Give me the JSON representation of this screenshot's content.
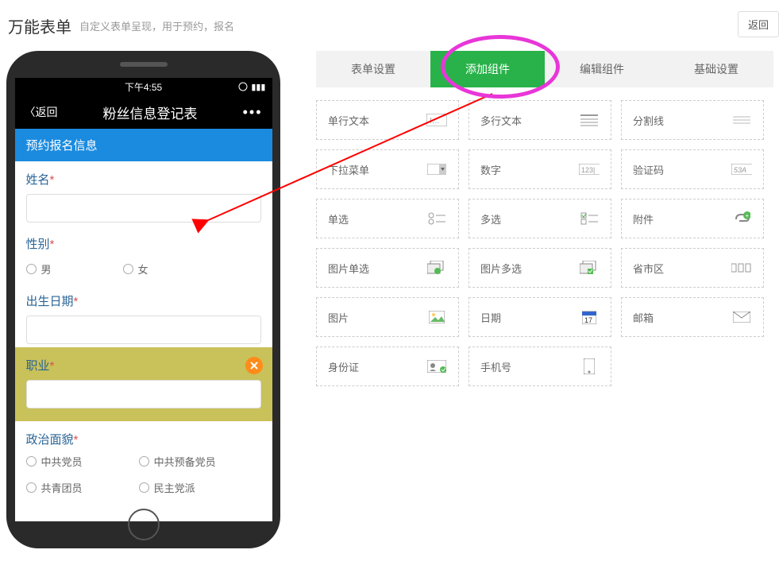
{
  "header": {
    "title": "万能表单",
    "subtitle": "自定义表单呈现，用于预约，报名",
    "back_btn": "返回"
  },
  "phone": {
    "status_time": "下午4:55",
    "nav_back": "返回",
    "nav_title": "粉丝信息登记表",
    "nav_more": "•••",
    "section_header": "预约报名信息",
    "fields": {
      "name_label": "姓名",
      "gender_label": "性别",
      "gender_opt1": "男",
      "gender_opt2": "女",
      "birth_label": "出生日期",
      "job_label": "职业",
      "political_label": "政治面貌",
      "pol_opt1": "中共党员",
      "pol_opt2": "中共预备党员",
      "pol_opt3": "共青团员",
      "pol_opt4": "民主党派"
    }
  },
  "tabs": {
    "t1": "表单设置",
    "t2": "添加组件",
    "t3": "编辑组件",
    "t4": "基础设置"
  },
  "components": [
    {
      "label": "单行文本"
    },
    {
      "label": "多行文本"
    },
    {
      "label": "分割线"
    },
    {
      "label": "下拉菜单"
    },
    {
      "label": "数字"
    },
    {
      "label": "验证码"
    },
    {
      "label": "单选"
    },
    {
      "label": "多选"
    },
    {
      "label": "附件"
    },
    {
      "label": "图片单选"
    },
    {
      "label": "图片多选"
    },
    {
      "label": "省市区"
    },
    {
      "label": "图片"
    },
    {
      "label": "日期"
    },
    {
      "label": "邮箱"
    },
    {
      "label": "身份证"
    },
    {
      "label": "手机号"
    }
  ]
}
